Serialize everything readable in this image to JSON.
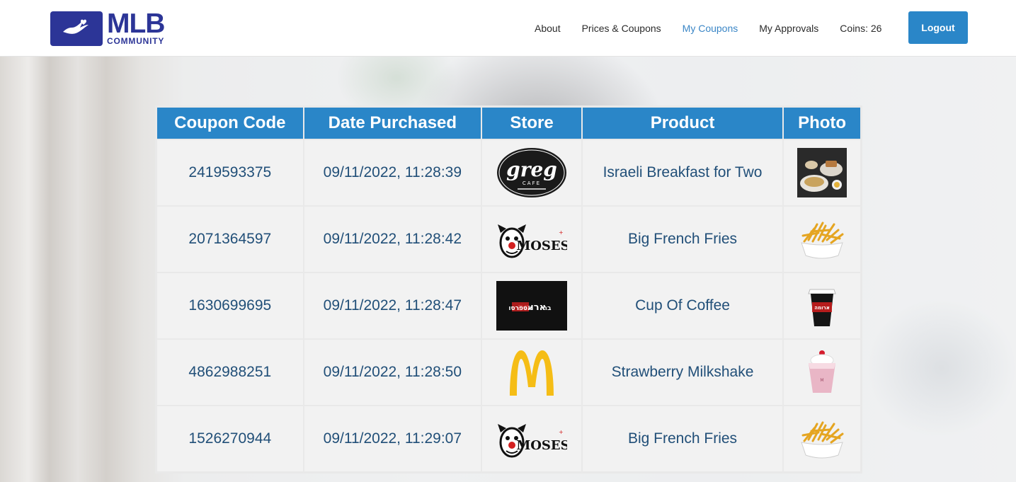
{
  "brand": {
    "name": "MLB",
    "sub": "COMMUNITY",
    "logo_icon": "hand-heart-icon",
    "color": "#2c3597"
  },
  "nav": {
    "items": [
      {
        "label": "About",
        "active": false
      },
      {
        "label": "Prices & Coupons",
        "active": false
      },
      {
        "label": "My Coupons",
        "active": true
      },
      {
        "label": "My Approvals",
        "active": false
      }
    ],
    "coins": "Coins: 26",
    "logout": "Logout",
    "accent": "#2a86c8",
    "active_color": "#3a86c6"
  },
  "table": {
    "headers": [
      "Coupon Code",
      "Date Purchased",
      "Store",
      "Product",
      "Photo"
    ],
    "rows": [
      {
        "code": "2419593375",
        "date": "09/11/2022, 11:28:39",
        "store": "greg-cafe-logo",
        "product": "Israeli Breakfast for Two",
        "photo": "breakfast-photo"
      },
      {
        "code": "2071364597",
        "date": "09/11/2022, 11:28:42",
        "store": "moses-logo",
        "product": "Big French Fries",
        "photo": "fries-photo"
      },
      {
        "code": "1630699695",
        "date": "09/11/2022, 11:28:47",
        "store": "aroma-logo",
        "product": "Cup Of Coffee",
        "photo": "coffee-cup-photo"
      },
      {
        "code": "4862988251",
        "date": "09/11/2022, 11:28:50",
        "store": "mcdonalds-logo",
        "product": "Strawberry Milkshake",
        "photo": "milkshake-photo"
      },
      {
        "code": "1526270944",
        "date": "09/11/2022, 11:29:07",
        "store": "moses-logo",
        "product": "Big French Fries",
        "photo": "fries-photo"
      }
    ]
  }
}
